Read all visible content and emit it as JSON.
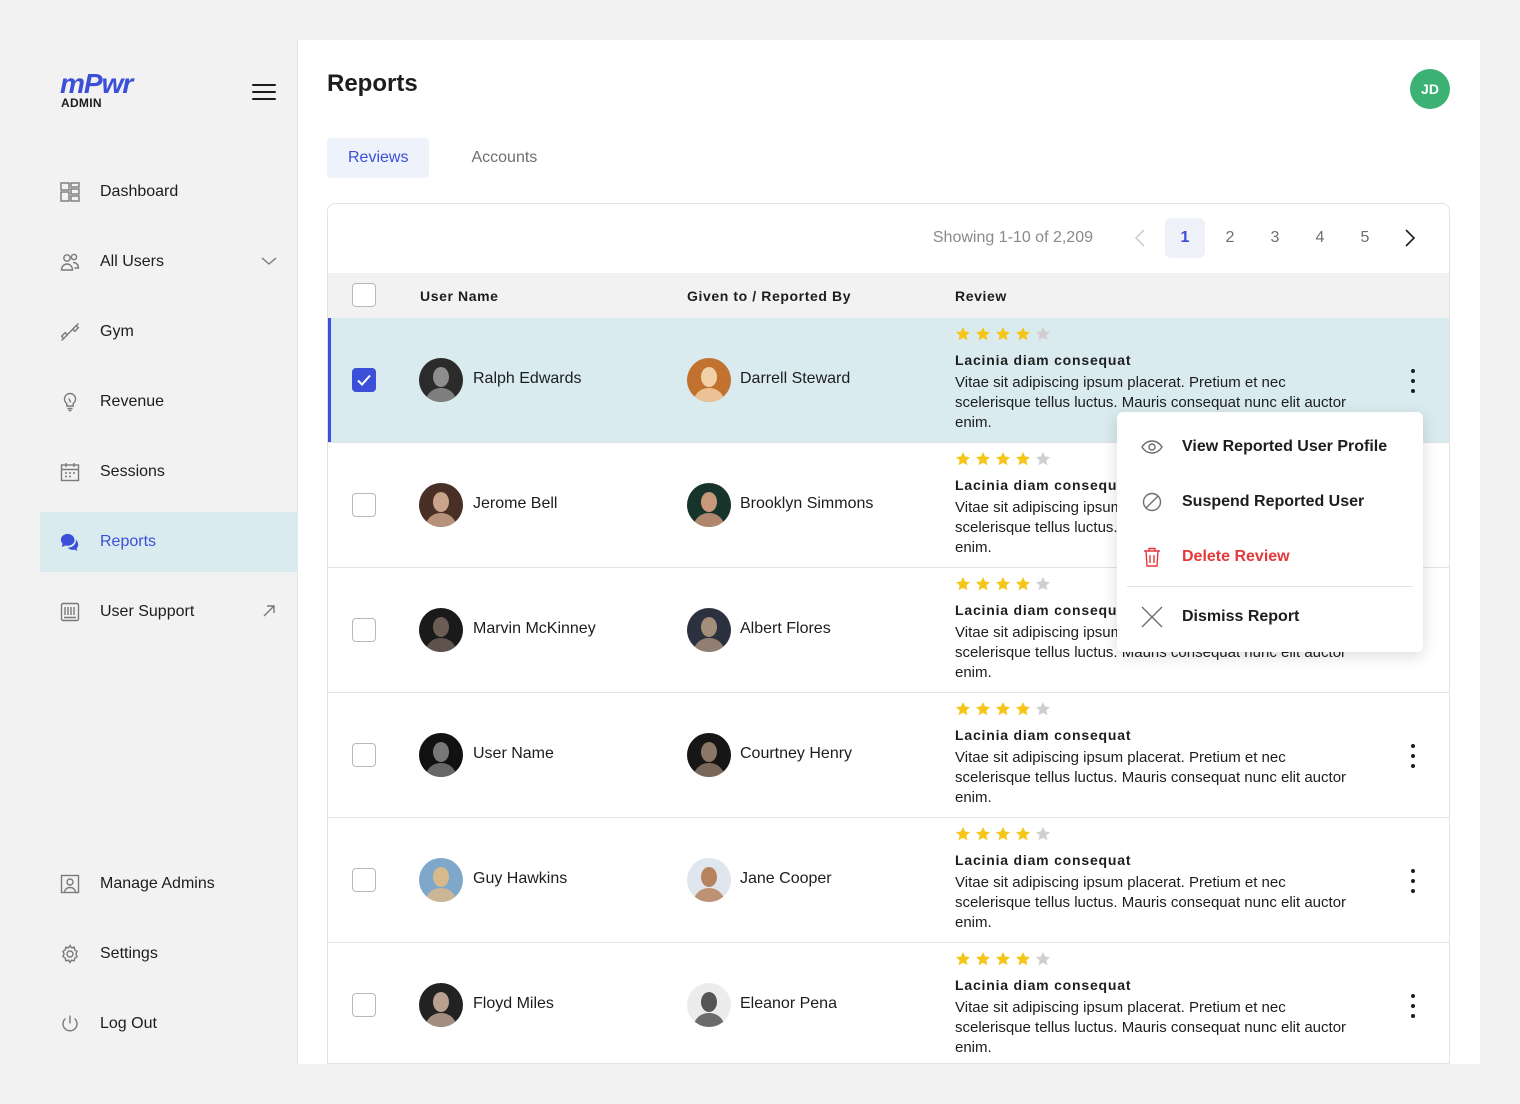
{
  "brand": {
    "name": "mPwr",
    "sub": "ADMIN"
  },
  "user_avatar": {
    "initials": "JD",
    "color": "#3bb273"
  },
  "sidebar": {
    "items": [
      {
        "label": "Dashboard",
        "icon": "dashboard-icon"
      },
      {
        "label": "All Users",
        "icon": "users-icon",
        "trail": "chevron-down-icon"
      },
      {
        "label": "Gym",
        "icon": "dumbbell-icon"
      },
      {
        "label": "Revenue",
        "icon": "lightbulb-icon"
      },
      {
        "label": "Sessions",
        "icon": "calendar-icon"
      },
      {
        "label": "Reports",
        "icon": "chat-icon",
        "active": true
      },
      {
        "label": "User Support",
        "icon": "keyboard-icon",
        "trail": "external-arrow-icon"
      }
    ],
    "bottom_items": [
      {
        "label": "Manage Admins",
        "icon": "admin-badge-icon"
      },
      {
        "label": "Settings",
        "icon": "gear-icon"
      },
      {
        "label": "Log Out",
        "icon": "power-icon"
      }
    ]
  },
  "main": {
    "title": "Reports",
    "tabs": [
      {
        "label": "Reviews",
        "active": true
      },
      {
        "label": "Accounts"
      }
    ]
  },
  "pagination": {
    "showing": "Showing 1-10 of 2,209",
    "pages": [
      "1",
      "2",
      "3",
      "4",
      "5"
    ],
    "current": "1"
  },
  "table": {
    "headers": {
      "user": "User Name",
      "given": "Given to / Reported By",
      "review": "Review"
    },
    "rows": [
      {
        "user": "Ralph Edwards",
        "given": "Darrell Steward",
        "rating": 4,
        "title": "Lacinia diam consequat",
        "body": "Vitae sit adipiscing ipsum placerat. Pretium et nec scelerisque tellus luctus. Mauris consequat nunc elit auctor enim.",
        "selected": true
      },
      {
        "user": "Jerome Bell",
        "given": "Brooklyn Simmons",
        "rating": 4,
        "title": "Lacinia diam consequat",
        "body": "Vitae sit adipiscing ipsum placerat. Pretium et nec scelerisque tellus luctus. Mauris consequat nunc elit auctor enim."
      },
      {
        "user": "Marvin McKinney",
        "given": "Albert Flores",
        "rating": 4,
        "title": "Lacinia diam consequat",
        "body": "Vitae sit adipiscing ipsum placerat. Pretium et nec scelerisque tellus luctus. Mauris consequat nunc elit auctor enim."
      },
      {
        "user": "User Name",
        "given": "Courtney Henry",
        "rating": 4,
        "title": "Lacinia diam consequat",
        "body": "Vitae sit adipiscing ipsum placerat. Pretium et nec scelerisque tellus luctus. Mauris consequat nunc elit auctor enim."
      },
      {
        "user": "Guy Hawkins",
        "given": "Jane Cooper",
        "rating": 4,
        "title": "Lacinia diam consequat",
        "body": "Vitae sit adipiscing ipsum placerat. Pretium et nec scelerisque tellus luctus. Mauris consequat nunc elit auctor enim."
      },
      {
        "user": "Floyd Miles",
        "given": "Eleanor Pena",
        "rating": 4,
        "title": "Lacinia diam consequat",
        "body": "Vitae sit adipiscing ipsum placerat. Pretium et nec scelerisque tellus luctus. Mauris consequat nunc elit auctor enim."
      }
    ]
  },
  "context_menu": {
    "items": [
      {
        "label": "View Reported User Profile",
        "icon": "eye-icon"
      },
      {
        "label": "Suspend Reported User",
        "icon": "ban-icon"
      },
      {
        "label": "Delete Review",
        "icon": "trash-icon",
        "danger": true
      },
      {
        "label": "Dismiss Report",
        "icon": "close-icon"
      }
    ]
  },
  "colors": {
    "accent": "#3b4fd8",
    "selected_row": "#d9ebee",
    "star": "#f5c518",
    "star_empty": "#cfcfcf",
    "danger": "#e5383b"
  }
}
